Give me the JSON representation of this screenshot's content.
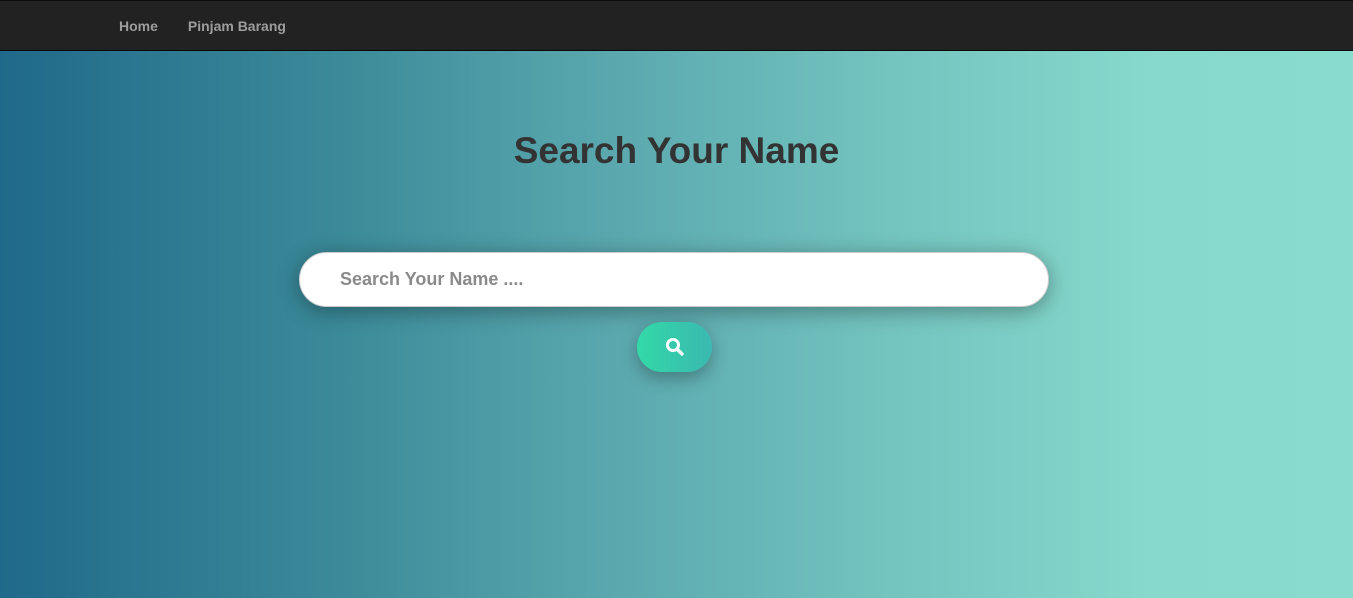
{
  "nav": {
    "items": [
      {
        "label": "Home"
      },
      {
        "label": "Pinjam Barang"
      }
    ]
  },
  "main": {
    "title": "Search Your Name",
    "search": {
      "placeholder": "Search Your Name ....",
      "value": ""
    },
    "search_button_icon": "search-icon"
  },
  "colors": {
    "navbar": "#222222",
    "nav_text": "#9d9d9d",
    "gradient_start": "#20698a",
    "gradient_end": "#88dccf",
    "title": "#333333",
    "button_start": "#33d9a8",
    "button_end": "#3ab9b0"
  }
}
